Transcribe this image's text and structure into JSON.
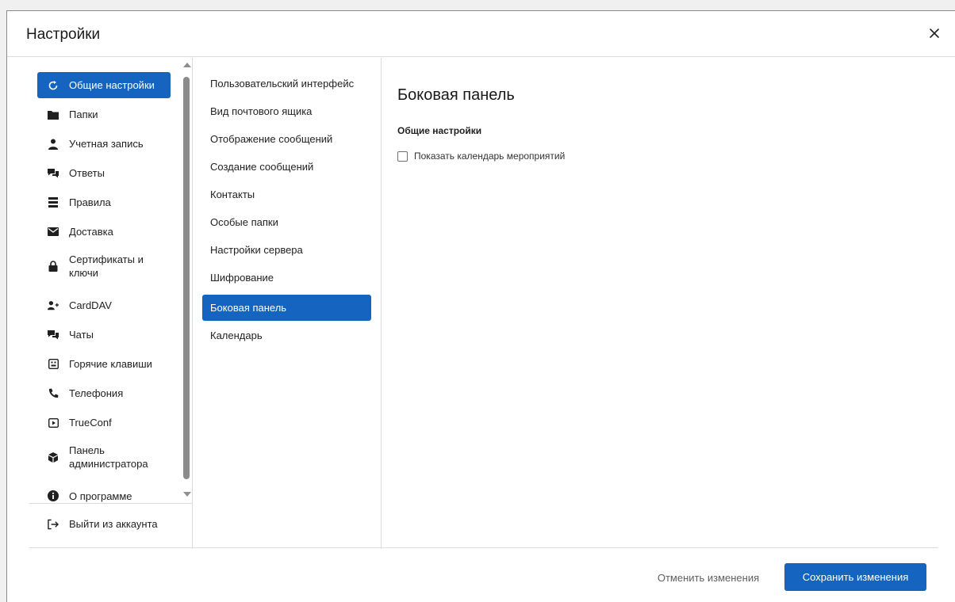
{
  "dialog": {
    "title": "Настройки",
    "close_icon": "close-icon"
  },
  "sidebar": {
    "items": [
      {
        "label": "Общие настройки",
        "icon": "refresh-icon",
        "active": true
      },
      {
        "label": "Папки",
        "icon": "folder-icon"
      },
      {
        "label": "Учетная запись",
        "icon": "user-icon"
      },
      {
        "label": "Ответы",
        "icon": "chat-icon"
      },
      {
        "label": "Правила",
        "icon": "rules-icon"
      },
      {
        "label": "Доставка",
        "icon": "envelope-icon"
      },
      {
        "label": "Сертификаты и ключи",
        "icon": "lock-icon"
      },
      {
        "label": "CardDAV",
        "icon": "add-user-icon"
      },
      {
        "label": "Чаты",
        "icon": "chat-icon"
      },
      {
        "label": "Горячие клавиши",
        "icon": "keyboard-icon"
      },
      {
        "label": "Телефония",
        "icon": "phone-icon"
      },
      {
        "label": "TrueConf",
        "icon": "video-icon"
      },
      {
        "label": "Панель администратора",
        "icon": "admin-icon"
      },
      {
        "label": "О программе",
        "icon": "info-icon"
      }
    ],
    "logout_label": "Выйти из аккаунта"
  },
  "submenu": {
    "items": [
      {
        "label": "Пользовательский интерфейс"
      },
      {
        "label": "Вид почтового ящика"
      },
      {
        "label": "Отображение сообщений"
      },
      {
        "label": "Создание сообщений"
      },
      {
        "label": "Контакты"
      },
      {
        "label": "Особые папки"
      },
      {
        "label": "Настройки сервера"
      },
      {
        "label": "Шифрование"
      },
      {
        "label": "Боковая панель",
        "active": true
      },
      {
        "label": "Календарь"
      }
    ]
  },
  "content": {
    "title": "Боковая панель",
    "section_title": "Общие настройки",
    "checkbox_label": "Показать календарь мероприятий",
    "checkbox_checked": false
  },
  "footer": {
    "cancel_label": "Отменить изменения",
    "save_label": "Сохранить изменения"
  },
  "colors": {
    "accent": "#1565c0",
    "text": "#1f1f1f",
    "divider": "#dcdcdc"
  }
}
